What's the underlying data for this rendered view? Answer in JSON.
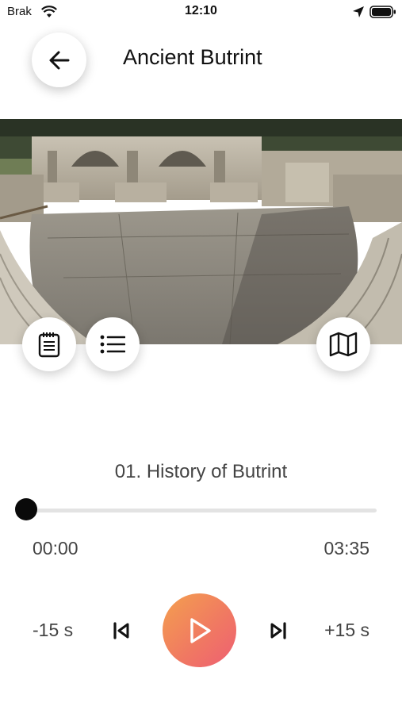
{
  "status_bar": {
    "carrier": "Brak",
    "time": "12:10",
    "icons": [
      "wifi-icon",
      "location-arrow-icon",
      "battery-icon"
    ]
  },
  "header": {
    "title": "Ancient Butrint",
    "back_icon": "arrow-left-icon"
  },
  "hero": {
    "image_subject": "ancient theatre ruins",
    "action_icons": [
      "notepad-icon",
      "list-icon",
      "map-icon"
    ]
  },
  "player": {
    "track_title": "01. History of Butrint",
    "current_time": "00:00",
    "total_time": "03:35",
    "progress": 0.0,
    "rewind_label": "-15 s",
    "forward_label": "+15 s",
    "icons": [
      "skip-previous-icon",
      "play-icon",
      "skip-next-icon"
    ]
  },
  "colors": {
    "play_gradient_start": "#f4a04e",
    "play_gradient_end": "#ee5f73",
    "progress_track": "#e3e3e3",
    "progress_thumb": "#0a0a0a"
  }
}
